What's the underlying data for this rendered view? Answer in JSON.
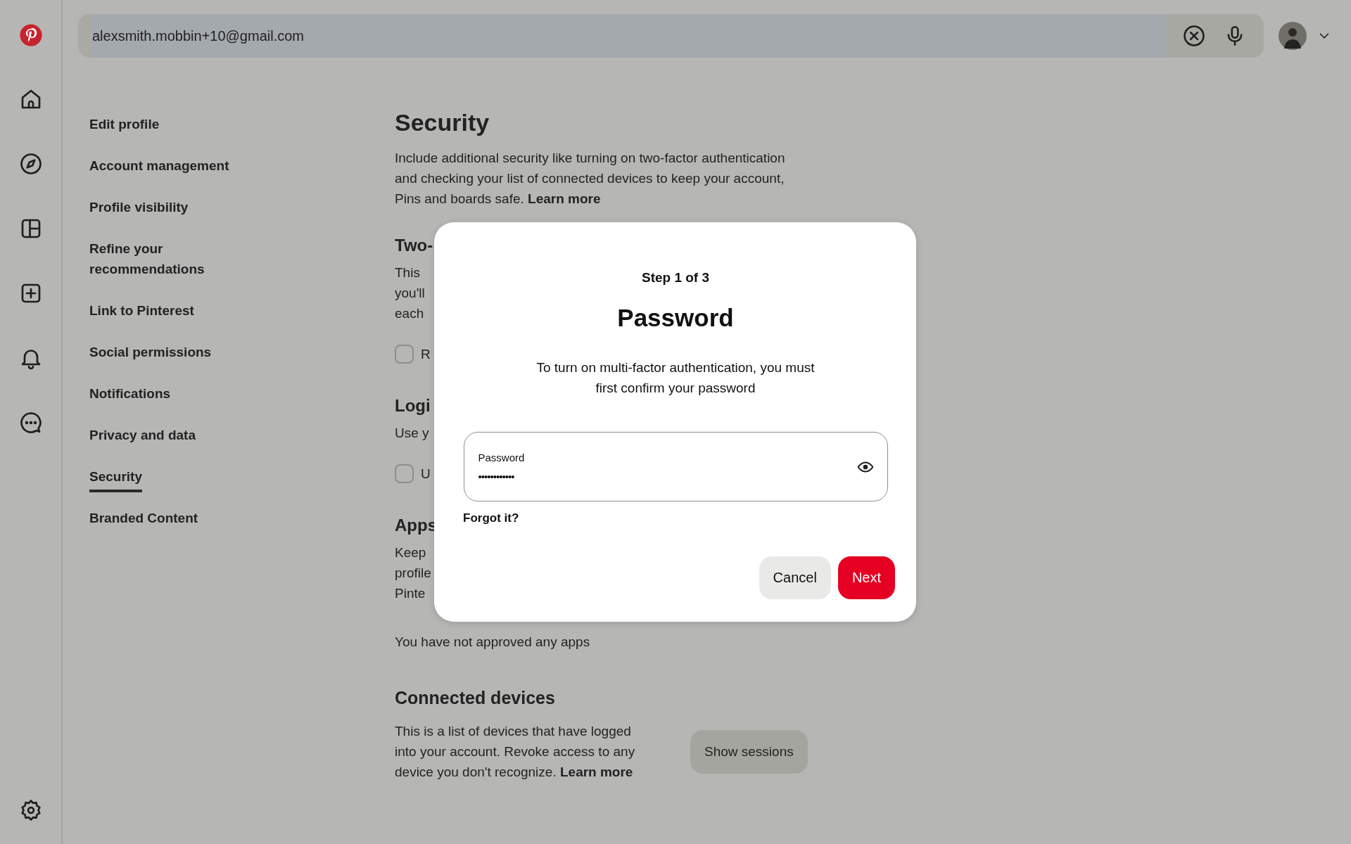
{
  "search": {
    "value": "alexsmith.mobbin+10@gmail.com"
  },
  "nav": [
    {
      "label": "Edit profile",
      "selected": false
    },
    {
      "label": "Account management",
      "selected": false
    },
    {
      "label": "Profile visibility",
      "selected": false
    },
    {
      "label": "Refine your recommendations",
      "selected": false
    },
    {
      "label": "Link to Pinterest",
      "selected": false
    },
    {
      "label": "Social permissions",
      "selected": false
    },
    {
      "label": "Notifications",
      "selected": false
    },
    {
      "label": "Privacy and data",
      "selected": false
    },
    {
      "label": "Security",
      "selected": true
    },
    {
      "label": "Branded Content",
      "selected": false
    }
  ],
  "page": {
    "title": "Security",
    "intro": {
      "text": "Include additional security like turning on two-factor authentication and checking your list of connected devices to keep your account, Pins and boards safe.",
      "link": "Learn more"
    },
    "covered_sections": [
      {
        "heading": "Two-",
        "lines": [
          "This",
          "you'll",
          "each"
        ],
        "checkbox": {
          "label": "R",
          "checked": false
        }
      },
      {
        "heading": "Logi",
        "lines": [
          "Use y"
        ],
        "checkbox": {
          "label": "U",
          "checked": false
        }
      },
      {
        "heading": "Apps",
        "lines": [
          "Keep",
          "profile",
          "Pinte"
        ]
      }
    ],
    "apps_note": "You have not approved any apps",
    "devices": {
      "heading": "Connected devices",
      "text": "This is a list of devices that have logged into your account. Revoke access to any device you don't recognize.",
      "link": "Learn more",
      "button": "Show sessions"
    }
  },
  "dialog": {
    "step": "Step 1 of 3",
    "title": "Password",
    "text": "To turn on multi-factor authentication, you must first confirm your password",
    "field": {
      "label": "Password",
      "value": "••••••••••••"
    },
    "forgot": "Forgot it?",
    "buttons": [
      {
        "label": "Cancel",
        "kind": "secondary"
      },
      {
        "label": "Next",
        "kind": "primary"
      }
    ]
  }
}
